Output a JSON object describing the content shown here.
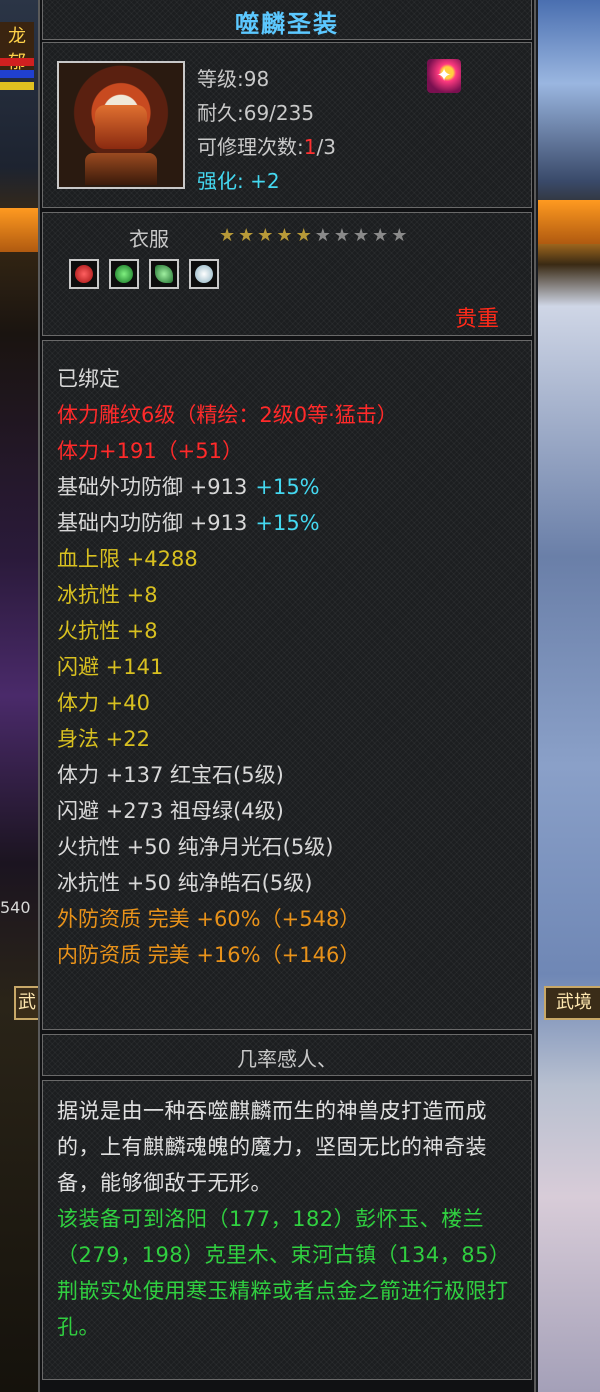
{
  "item": {
    "name": "噬麟圣装",
    "level_label": "等级:98",
    "durability_label": "耐久:69/235",
    "repair_prefix": "可修理次数:",
    "repair_used": "1",
    "repair_total": "/3",
    "enhance_label": "强化: +2",
    "category": "衣服",
    "stars_filled": 5,
    "stars_total": 10,
    "rarity": "贵重"
  },
  "stats": [
    {
      "text": "已绑定",
      "color": "white"
    },
    {
      "text": "体力雕纹6级（精绘：2级0等·猛击）",
      "color": "red"
    },
    {
      "text": "体力+191（+51）",
      "color": "red"
    },
    {
      "text": "基础外功防御 +913",
      "extra": "+15%",
      "color": "white"
    },
    {
      "text": "基础内功防御 +913",
      "extra": "+15%",
      "color": "white"
    },
    {
      "text": "血上限 +4288",
      "color": "yellow"
    },
    {
      "text": "冰抗性 +8",
      "color": "yellow"
    },
    {
      "text": "火抗性 +8",
      "color": "yellow"
    },
    {
      "text": "闪避 +141",
      "color": "yellow"
    },
    {
      "text": "体力 +40",
      "color": "yellow"
    },
    {
      "text": "身法 +22",
      "color": "yellow"
    },
    {
      "text": "体力 +137 红宝石(5级)",
      "color": "white"
    },
    {
      "text": "闪避 +273 祖母绿(4级)",
      "color": "white"
    },
    {
      "text": "火抗性 +50 纯净月光石(5级)",
      "color": "white"
    },
    {
      "text": "冰抗性 +50 纯净皓石(5级)",
      "color": "white"
    },
    {
      "text": "外防资质  完美 +60%（+548）",
      "color": "orange"
    },
    {
      "text": "内防资质  完美 +16%（+146）",
      "color": "orange"
    }
  ],
  "flavor_title": "几率感人、",
  "description": "据说是由一种吞噬麒麟而生的神兽皮打造而成的，上有麒麟魂魄的魔力，坚固无比的神奇装备，能够御敌于无形。",
  "hint": "该装备可到洛阳（177，182）彭怀玉、楼兰（279，198）克里木、束河古镇（134，85）荆嵌实处使用寒玉精粹或者点金之箭进行极限打孔。",
  "background": {
    "left_text": "龙郁",
    "number_text": "540",
    "btn_left": "武",
    "btn_right": "武境"
  },
  "colors": {
    "title": "#5cc8ff",
    "red": "#ff2a2a",
    "yellow": "#d8c020",
    "orange": "#e8921a",
    "cyan": "#44d8f0",
    "green": "#30d040"
  }
}
